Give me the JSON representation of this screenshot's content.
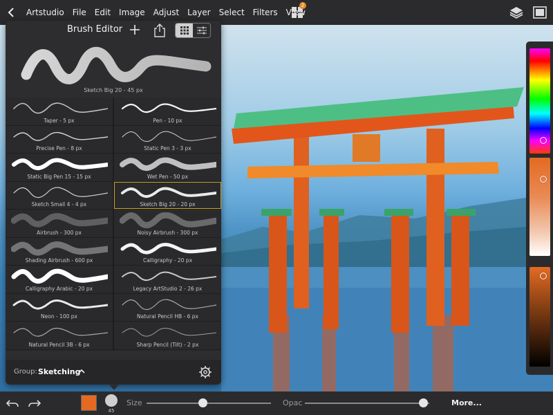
{
  "menubar": {
    "items": [
      "Artstudio",
      "File",
      "Edit",
      "Image",
      "Adjust",
      "Layer",
      "Select",
      "Filters",
      "View"
    ],
    "grid_badge": "2"
  },
  "brush_editor": {
    "title": "Brush Editor",
    "preview_caption": "Sketch Big 20 - 45 px",
    "brushes": [
      {
        "label": "Taper - 5 px"
      },
      {
        "label": "Pen - 10 px"
      },
      {
        "label": "Precise Pen - 8 px"
      },
      {
        "label": "Static Pen 3 - 3 px"
      },
      {
        "label": "Static Big Pen 15 - 15 px"
      },
      {
        "label": "Wet Pen - 50 px"
      },
      {
        "label": "Sketch Small 4 - 4 px"
      },
      {
        "label": "Sketch Big 20 - 20 px"
      },
      {
        "label": "Airbrush - 300 px"
      },
      {
        "label": "Noisy Airbrush - 300 px"
      },
      {
        "label": "Shading Airbrush - 600 px"
      },
      {
        "label": "Calligraphy - 20 px"
      },
      {
        "label": "Calligraphy Arabic - 20 px"
      },
      {
        "label": "Legacy ArtStudio 2 - 26 px"
      },
      {
        "label": "Neon - 100 px"
      },
      {
        "label": "Natural Pencil HB - 6 px"
      },
      {
        "label": "Natural Pencil 3B - 6 px"
      },
      {
        "label": "Sharp Pencil (Tilt) - 2 px"
      },
      {
        "label": ""
      },
      {
        "label": ""
      }
    ],
    "selected_brush": "Sketch Big 20 - 20 px",
    "group_label": "Group:",
    "group_value": "Sketching"
  },
  "color": {
    "current": "#e46a22",
    "hue_level": 0.9,
    "saturation_level": 0.2,
    "value_level": 0.06
  },
  "bottom_bar": {
    "size_label": "Size",
    "size_value": "45",
    "size_level": 0.45,
    "opacity_label": "Opac",
    "opacity_level": 0.95,
    "more_label": "More..."
  }
}
